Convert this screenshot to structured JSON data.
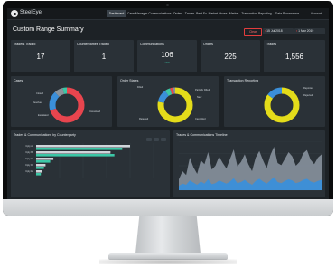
{
  "app": {
    "name": "SteelEye"
  },
  "nav": {
    "items": [
      {
        "label": "Dashboard",
        "active": true
      },
      {
        "label": "Case Manager",
        "active": false
      },
      {
        "label": "Communications",
        "active": false
      },
      {
        "label": "Orders",
        "active": false
      },
      {
        "label": "Trades",
        "active": false
      },
      {
        "label": "Best Ex",
        "active": false
      },
      {
        "label": "Market Abuse",
        "active": false
      },
      {
        "label": "Market",
        "active": false
      },
      {
        "label": "Transaction Reporting",
        "active": false
      },
      {
        "label": "Data Provenance",
        "active": false
      },
      {
        "label": "Account",
        "active": false
      }
    ]
  },
  "header": {
    "title": "Custom Range Summary",
    "clear_label": "Clear",
    "date_from": "15 Jul 2018",
    "date_to": "1 Mar 2019"
  },
  "stats": [
    {
      "title": "Traders Traded",
      "value": "17",
      "sub": ""
    },
    {
      "title": "Counterparties Traded",
      "value": "1",
      "sub": ""
    },
    {
      "title": "Communications",
      "value": "106",
      "sub": "-5%"
    },
    {
      "title": "Orders",
      "value": "225",
      "sub": ""
    },
    {
      "title": "Trades",
      "value": "1,556",
      "sub": ""
    }
  ],
  "panels": {
    "cases": {
      "title": "Cases",
      "legend": [
        "Closed",
        "Resolved",
        "Unresolved",
        "Escalated"
      ]
    },
    "order_states": {
      "title": "Order States",
      "legend": [
        "Filled",
        "Partially Filled",
        "New",
        "Rejected",
        "Cancelled"
      ]
    },
    "transaction_reporting": {
      "title": "Transaction Reporting",
      "legend": [
        "Reported",
        "Rejected"
      ]
    },
    "trades_comms_counterparty": {
      "title": "Trades & Communications by Counterparty",
      "bar_labels": [
        "Cpty A",
        "Cpty B",
        "Cpty C",
        "Cpty D",
        "Cpty E"
      ]
    },
    "trades_comms_timeline": {
      "title": "Trades & Communications Timeline"
    }
  },
  "colors": {
    "accent": "#3cc7a6",
    "red": "#e8454e",
    "blue": "#3b8fd9",
    "yellow": "#e4dc1a",
    "bg": "#1d2226",
    "card": "#2a3137"
  },
  "chart_data": [
    {
      "type": "pie",
      "title": "Cases",
      "labels": [
        "Closed",
        "Resolved",
        "Unresolved",
        "Escalated"
      ],
      "values": [
        70,
        18,
        8,
        4
      ],
      "colors": [
        "#e8454e",
        "#3b8fd9",
        "#8a939b",
        "#3cc7a6"
      ]
    },
    {
      "type": "pie",
      "title": "Order States",
      "labels": [
        "Filled",
        "Partially Filled",
        "New",
        "Rejected",
        "Cancelled"
      ],
      "values": [
        78,
        12,
        5,
        3,
        2
      ],
      "colors": [
        "#e4dc1a",
        "#3b8fd9",
        "#3cc7a6",
        "#e8454e",
        "#8a939b"
      ]
    },
    {
      "type": "pie",
      "title": "Transaction Reporting",
      "labels": [
        "Reported",
        "Rejected"
      ],
      "values": [
        85,
        15
      ],
      "colors": [
        "#e4dc1a",
        "#3b8fd9"
      ]
    },
    {
      "type": "bar",
      "orientation": "horizontal",
      "title": "Trades & Communications by Counterparty",
      "categories": [
        "Cpty A",
        "Cpty B",
        "Cpty C",
        "Cpty D",
        "Cpty E"
      ],
      "series": [
        {
          "name": "Trades",
          "values": [
            120,
            95,
            22,
            12,
            8
          ]
        },
        {
          "name": "Communications",
          "values": [
            110,
            100,
            18,
            10,
            6
          ]
        }
      ],
      "colors": [
        "#cfd5da",
        "#3cc7a6"
      ],
      "xlim": [
        0,
        150
      ]
    },
    {
      "type": "area",
      "title": "Trades & Communications Timeline",
      "series": [
        {
          "name": "Trades",
          "values": [
            20,
            35,
            28,
            60,
            42,
            30,
            55,
            48,
            70,
            38,
            45,
            62,
            50,
            40,
            58,
            75,
            44,
            52,
            66,
            48,
            35,
            60,
            72,
            55,
            40,
            64,
            80,
            50,
            46,
            58,
            70,
            62,
            45,
            52,
            68,
            74,
            56,
            48,
            60,
            66
          ]
        },
        {
          "name": "Communications",
          "values": [
            8,
            12,
            10,
            18,
            14,
            10,
            16,
            12,
            20,
            11,
            13,
            18,
            15,
            12,
            16,
            22,
            13,
            15,
            19,
            14,
            10,
            17,
            21,
            16,
            12,
            18,
            24,
            15,
            13,
            17,
            20,
            18,
            13,
            15,
            19,
            21,
            16,
            14,
            17,
            19
          ]
        }
      ],
      "colors": [
        "#8d98a3",
        "#3b8fd9"
      ],
      "ylim": [
        0,
        90
      ]
    }
  ]
}
